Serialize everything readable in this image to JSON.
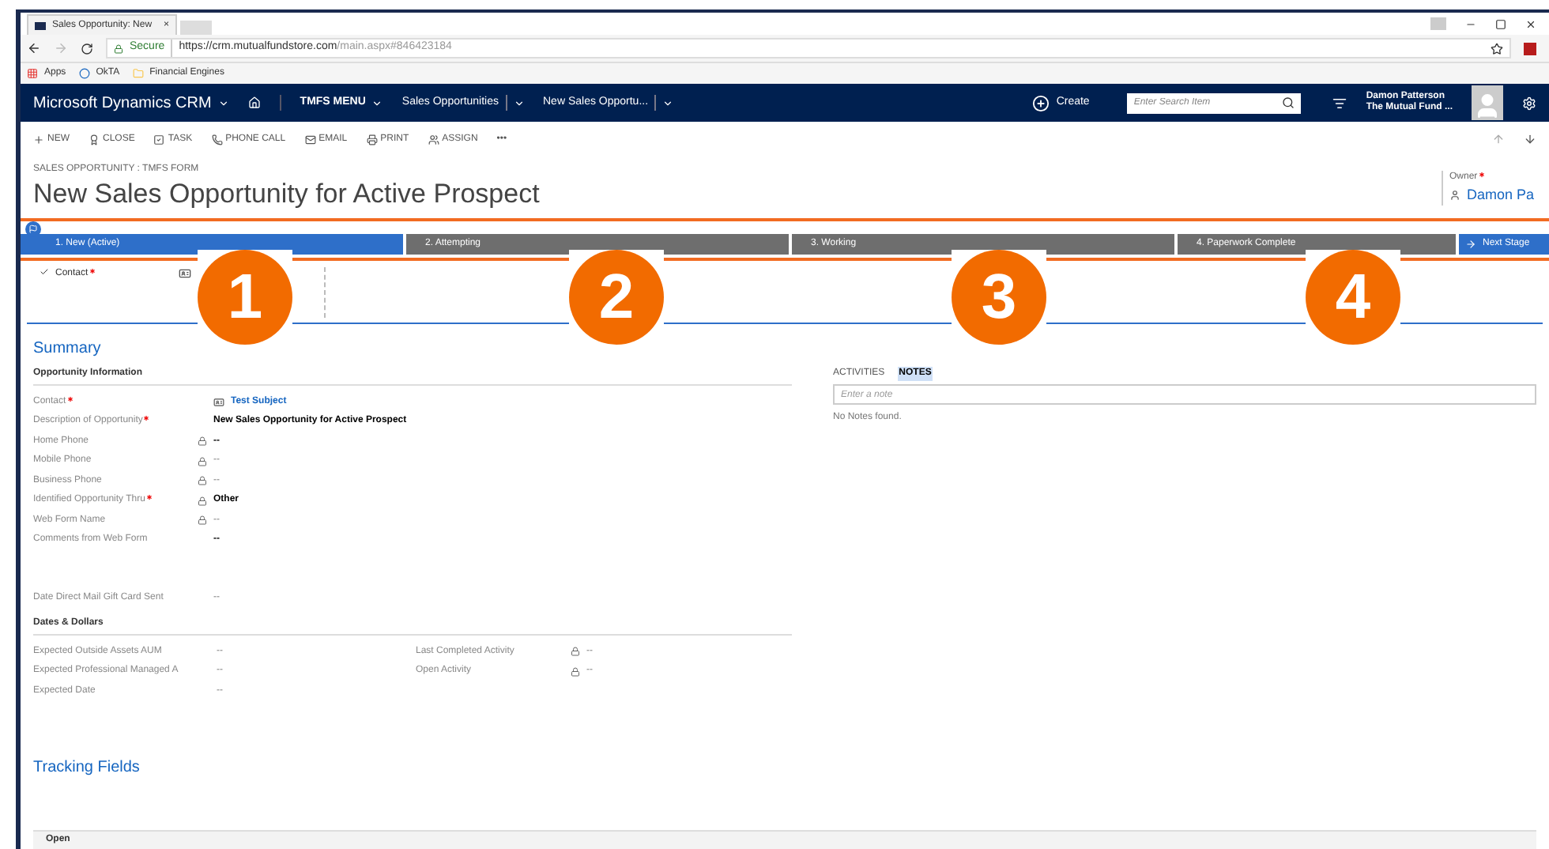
{
  "browser": {
    "tab_title": "Sales Opportunity: New",
    "tab_close": "×",
    "secure_label": "Secure",
    "url_host": "https://crm.mutualfundstore.com",
    "url_path": "/main.aspx#846423184",
    "bookmarks": [
      {
        "label": "Apps",
        "kind": "apps"
      },
      {
        "label": "OkTA",
        "kind": "okta"
      },
      {
        "label": "Financial Engines",
        "kind": "folder"
      }
    ]
  },
  "nav": {
    "brand": "Microsoft Dynamics CRM",
    "menu": "TMFS MENU",
    "crumbs": [
      "Sales Opportunities",
      "New Sales Opportu..."
    ],
    "create": "Create",
    "search": {
      "placeholder": "Enter Search Item"
    },
    "user_name": "Damon Patterson",
    "user_org": "The Mutual Fund ..."
  },
  "commands": [
    {
      "label": "NEW",
      "kind": "plus"
    },
    {
      "label": "CLOSE",
      "kind": "close"
    },
    {
      "label": "TASK",
      "kind": "task"
    },
    {
      "label": "PHONE CALL",
      "kind": "phone"
    },
    {
      "label": "EMAIL",
      "kind": "email"
    },
    {
      "label": "PRINT",
      "kind": "print"
    },
    {
      "label": "ASSIGN",
      "kind": "assign"
    },
    {
      "label": "•••",
      "kind": "more"
    }
  ],
  "form": {
    "entity": "SALES OPPORTUNITY : TMFS FORM",
    "title": "New Sales Opportunity for Active Prospect",
    "owner_label": "Owner",
    "owner": "Damon Pa"
  },
  "process": {
    "stages": [
      {
        "label": "1. New (Active)",
        "selected": true
      },
      {
        "label": "2. Attempting",
        "selected": false
      },
      {
        "label": "3. Working",
        "selected": false
      },
      {
        "label": "4. Paperwork Complete",
        "selected": false
      }
    ],
    "next": "Next Stage",
    "step_label": "Contact"
  },
  "annotations": [
    {
      "label": "1"
    },
    {
      "label": "2"
    },
    {
      "label": "3"
    },
    {
      "label": "4"
    }
  ],
  "summary": {
    "title": "Summary",
    "section": "Opportunity Information",
    "fields": [
      {
        "label": "Contact",
        "required": true,
        "locked": false,
        "value": "Test Subject",
        "kind": "link"
      },
      {
        "label": "Description of Opportunity",
        "required": true,
        "locked": false,
        "value": "New Sales Opportunity for Active Prospect",
        "kind": "bold"
      },
      {
        "label": "Home Phone",
        "required": false,
        "locked": true,
        "value": "--",
        "kind": "bold"
      },
      {
        "label": "Mobile Phone",
        "required": false,
        "locked": true,
        "value": "--",
        "kind": "plain"
      },
      {
        "label": "Business Phone",
        "required": false,
        "locked": true,
        "value": "--",
        "kind": "plain"
      },
      {
        "label": "Identified Opportunity Thru",
        "required": true,
        "locked": true,
        "value": "Other",
        "kind": "bold"
      },
      {
        "label": "Web Form Name",
        "required": false,
        "locked": true,
        "value": "--",
        "kind": "plain"
      },
      {
        "label": "Comments from Web Form",
        "required": false,
        "locked": false,
        "value": "--",
        "kind": "bold"
      }
    ],
    "gift_label": "Date Direct Mail Gift Card Sent",
    "gift_value": "--",
    "dates_section": "Dates & Dollars",
    "dates_left": [
      {
        "label": "Expected Outside Assets AUM",
        "locked": false,
        "value": "--"
      },
      {
        "label": "Expected Professional Managed A",
        "locked": false,
        "value": "--"
      },
      {
        "label": "Expected Date",
        "locked": false,
        "value": "--"
      }
    ],
    "dates_right": [
      {
        "label": "Last Completed Activity",
        "locked": true,
        "value": "--"
      },
      {
        "label": "Open Activity",
        "locked": true,
        "value": "--"
      }
    ]
  },
  "notes": {
    "tabs": [
      {
        "label": "ACTIVITIES",
        "selected": false
      },
      {
        "label": "NOTES",
        "selected": true
      }
    ],
    "placeholder": "Enter a note",
    "empty": "No Notes found."
  },
  "tracking": {
    "title": "Tracking Fields",
    "row": "Open"
  }
}
